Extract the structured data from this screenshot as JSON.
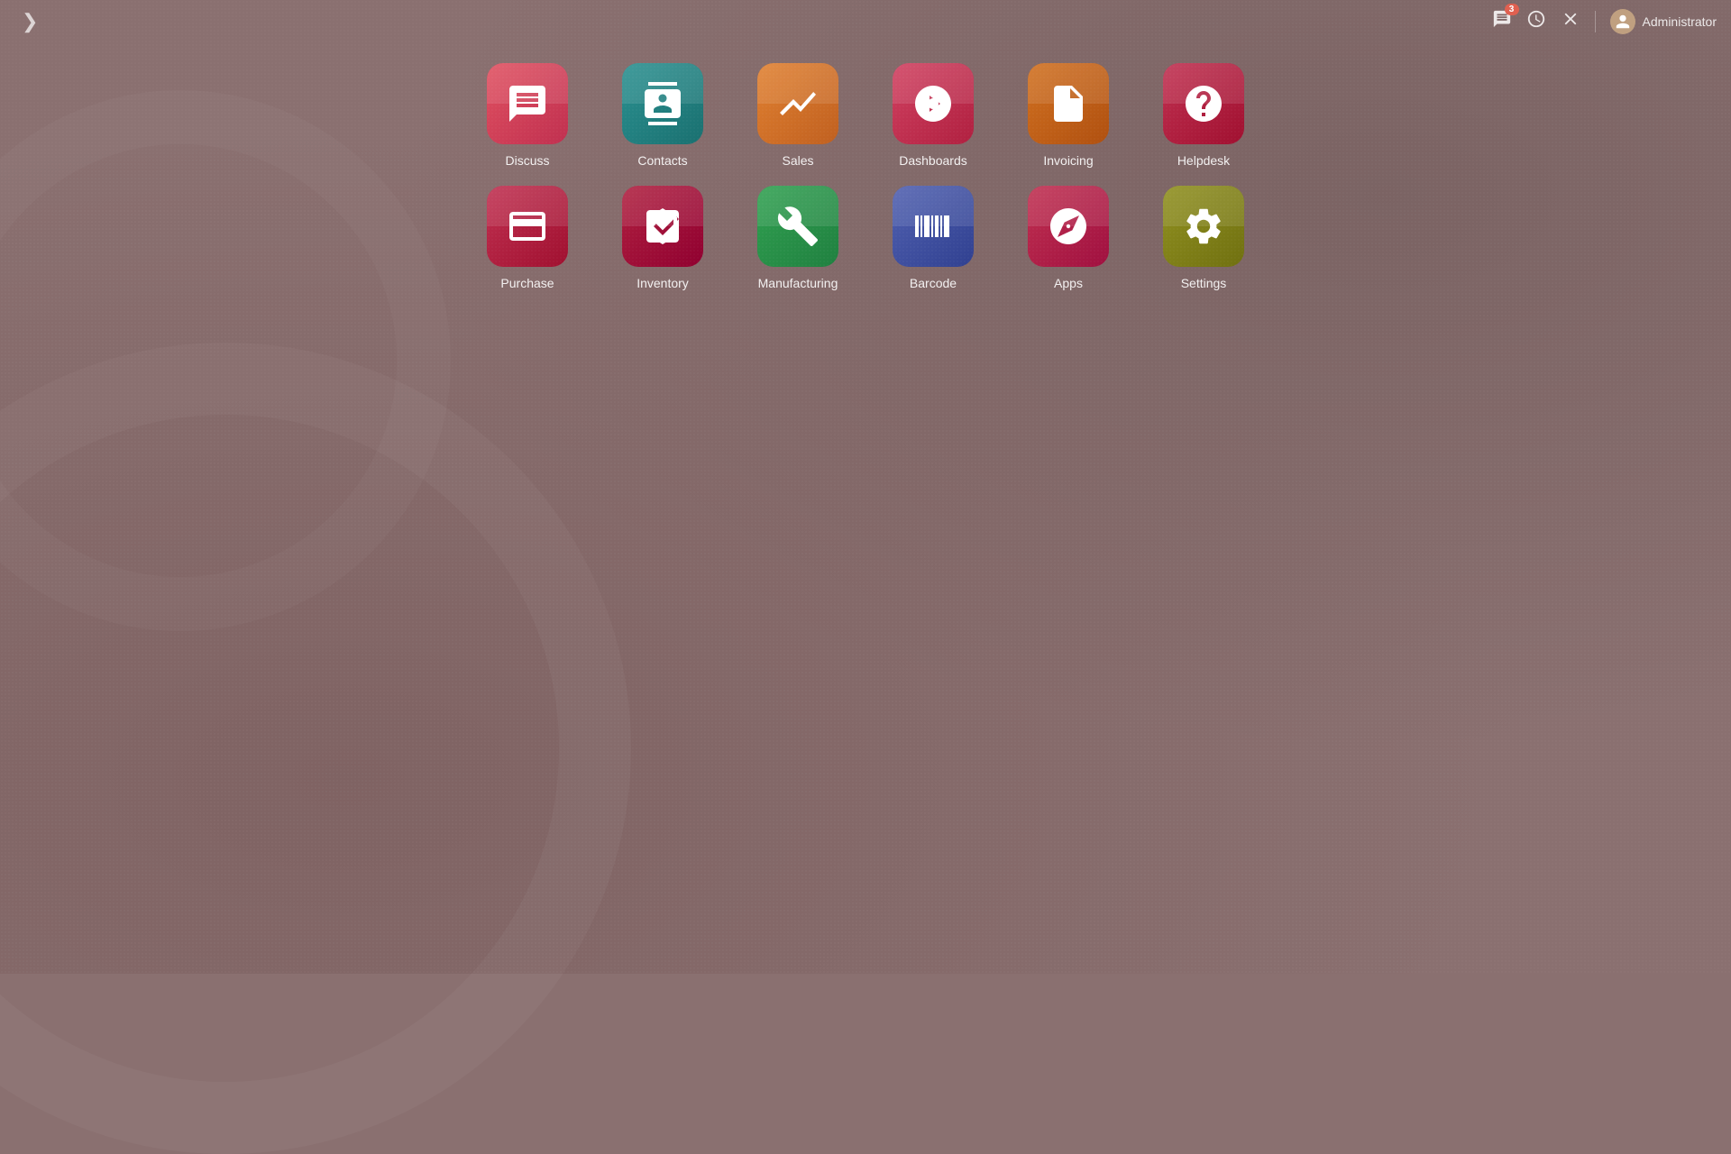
{
  "topbar": {
    "nav_arrow": "❯",
    "messages_count": "3",
    "admin_label": "Administrator"
  },
  "apps": [
    {
      "id": "discuss",
      "label": "Discuss",
      "color_class": "icon-discuss",
      "icon_type": "discuss"
    },
    {
      "id": "contacts",
      "label": "Contacts",
      "color_class": "icon-contacts",
      "icon_type": "contacts"
    },
    {
      "id": "sales",
      "label": "Sales",
      "color_class": "icon-sales",
      "icon_type": "sales"
    },
    {
      "id": "dashboards",
      "label": "Dashboards",
      "color_class": "icon-dashboards",
      "icon_type": "dashboards"
    },
    {
      "id": "invoicing",
      "label": "Invoicing",
      "color_class": "icon-invoicing",
      "icon_type": "invoicing"
    },
    {
      "id": "helpdesk",
      "label": "Helpdesk",
      "color_class": "icon-helpdesk",
      "icon_type": "helpdesk"
    },
    {
      "id": "purchase",
      "label": "Purchase",
      "color_class": "icon-purchase",
      "icon_type": "purchase"
    },
    {
      "id": "inventory",
      "label": "Inventory",
      "color_class": "icon-inventory",
      "icon_type": "inventory"
    },
    {
      "id": "manufacturing",
      "label": "Manufacturing",
      "color_class": "icon-manufacturing",
      "icon_type": "manufacturing"
    },
    {
      "id": "barcode",
      "label": "Barcode",
      "color_class": "icon-barcode",
      "icon_type": "barcode"
    },
    {
      "id": "apps",
      "label": "Apps",
      "color_class": "icon-apps",
      "icon_type": "apps"
    },
    {
      "id": "settings",
      "label": "Settings",
      "color_class": "icon-settings",
      "icon_type": "settings"
    }
  ]
}
